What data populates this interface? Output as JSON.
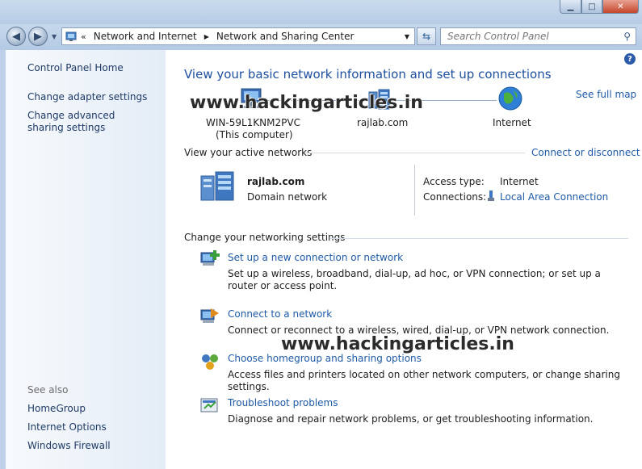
{
  "window": {
    "minimize_icon": "minimize-icon",
    "maximize_icon": "maximize-icon",
    "close_icon": "close-icon"
  },
  "navigation": {
    "breadcrumb": [
      "Network and Internet",
      "Network and Sharing Center"
    ],
    "search_placeholder": "Search Control Panel"
  },
  "sidebar": {
    "home": "Control Panel Home",
    "items": [
      "Change adapter settings",
      "Change advanced sharing settings"
    ],
    "see_also_heading": "See also",
    "see_also": [
      "HomeGroup",
      "Internet Options",
      "Windows Firewall"
    ]
  },
  "main": {
    "heading": "View your basic network information and set up connections",
    "see_full_map": "See full map",
    "map": {
      "computer_name": "WIN-59L1KNM2PVC",
      "computer_sub": "(This computer)",
      "domain": "rajlab.com",
      "internet": "Internet"
    },
    "active_networks_label": "View your active networks",
    "connect_disconnect": "Connect or disconnect",
    "network": {
      "name": "rajlab.com",
      "type": "Domain network",
      "access_type_label": "Access type:",
      "access_type_value": "Internet",
      "connections_label": "Connections:",
      "connection_value": "Local Area Connection"
    },
    "change_settings_label": "Change your networking settings",
    "tasks": [
      {
        "title": "Set up a new connection or network",
        "desc": "Set up a wireless, broadband, dial-up, ad hoc, or VPN connection; or set up a router or access point."
      },
      {
        "title": "Connect to a network",
        "desc": "Connect or reconnect to a wireless, wired, dial-up, or VPN network connection."
      },
      {
        "title": "Choose homegroup and sharing options",
        "desc": "Access files and printers located on other network computers, or change sharing settings."
      },
      {
        "title": "Troubleshoot problems",
        "desc": "Diagnose and repair network problems, or get troubleshooting information."
      }
    ],
    "watermark": "www.hackingarticles.in"
  },
  "colors": {
    "link": "#1e5aa8",
    "heading": "#1e4fa0",
    "sidebar_link": "#1e3a66"
  }
}
